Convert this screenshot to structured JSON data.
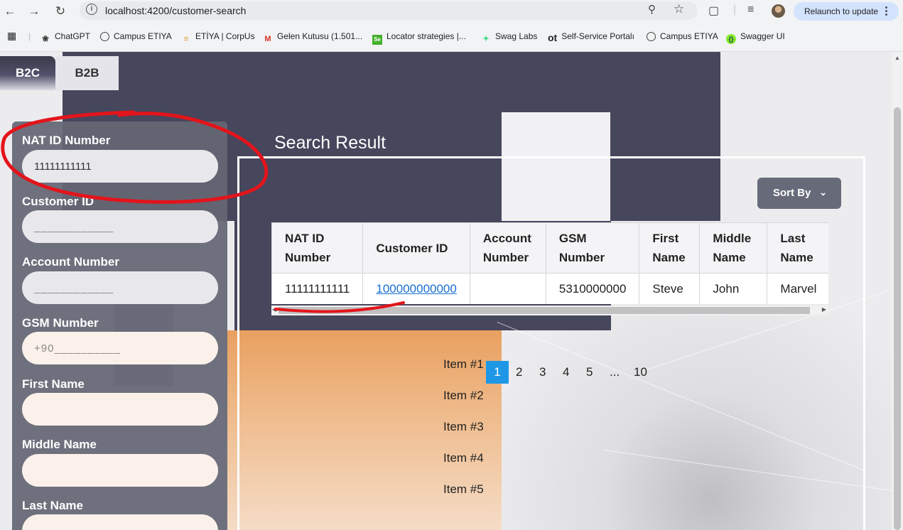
{
  "browser": {
    "url": "localhost:4200/customer-search",
    "relaunch_label": "Relaunch to update",
    "bookmarks": [
      {
        "label": "ChatGPT",
        "icon": "chatgpt-icon"
      },
      {
        "label": "Campus ETIYA",
        "icon": "globe-icon"
      },
      {
        "label": "ETİYA | CorpUs",
        "icon": "etiya-icon"
      },
      {
        "label": "Gelen Kutusu (1.501...",
        "icon": "gmail-icon"
      },
      {
        "label": "Locator strategies |...",
        "icon": "selenium-icon"
      },
      {
        "label": "Swag Labs",
        "icon": "swaglabs-icon"
      },
      {
        "label": "Self-Service Portalı",
        "icon": "ot-icon"
      },
      {
        "label": "Campus ETIYA",
        "icon": "globe-icon"
      },
      {
        "label": "Swagger UI",
        "icon": "swagger-icon"
      }
    ]
  },
  "tabs": {
    "b2c": "B2C",
    "b2b": "B2B"
  },
  "form": {
    "nat_id": {
      "label": "NAT ID Number",
      "value": "11111111111"
    },
    "customer_id": {
      "label": "Customer ID",
      "placeholder": "____________"
    },
    "account_number": {
      "label": "Account Number",
      "placeholder": "____________"
    },
    "gsm_number": {
      "label": "GSM Number",
      "placeholder": "+90__________"
    },
    "first_name": {
      "label": "First Name"
    },
    "middle_name": {
      "label": "Middle Name"
    },
    "last_name": {
      "label": "Last Name"
    }
  },
  "results": {
    "title": "Search Result",
    "sort_label": "Sort By",
    "columns": [
      "NAT ID Number",
      "Customer ID",
      "Account Number",
      "GSM Number",
      "First Name",
      "Middle Name",
      "Last Name"
    ],
    "rows": [
      {
        "nat_id": "11111111111",
        "customer_id": "100000000000",
        "account_number": "",
        "gsm_number": "5310000000",
        "first_name": "Steve",
        "middle_name": "John",
        "last_name": "Marvel"
      }
    ],
    "pagination": [
      "1",
      "2",
      "3",
      "4",
      "5",
      "...",
      "10"
    ],
    "current_page": "1",
    "items": [
      "Item #1",
      "Item #2",
      "Item #3",
      "Item #4",
      "Item #5"
    ]
  }
}
